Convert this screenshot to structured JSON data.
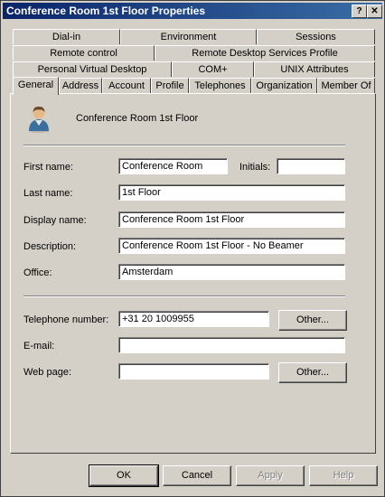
{
  "window": {
    "title": "Conference Room 1st Floor Properties",
    "help_glyph": "?",
    "close_glyph": "✕"
  },
  "tabs": {
    "row1": [
      "Dial-in",
      "Environment",
      "Sessions"
    ],
    "row2": [
      "Remote control",
      "Remote Desktop Services Profile"
    ],
    "row3": [
      "Personal Virtual Desktop",
      "COM+",
      "UNIX Attributes"
    ],
    "row4": [
      "General",
      "Address",
      "Account",
      "Profile",
      "Telephones",
      "Organization",
      "Member Of"
    ],
    "active": "General"
  },
  "general": {
    "display_title": "Conference Room 1st Floor",
    "icon": "user-icon",
    "fields": {
      "first_name_label": "First name:",
      "first_name": "Conference Room",
      "initials_label": "Initials:",
      "initials": "",
      "last_name_label": "Last name:",
      "last_name": "1st Floor",
      "display_name_label": "Display name:",
      "display_name": "Conference Room 1st Floor",
      "description_label": "Description:",
      "description": "Conference Room 1st Floor - No Beamer",
      "office_label": "Office:",
      "office": "Amsterdam",
      "telephone_label": "Telephone number:",
      "telephone": "+31 20 1009955",
      "email_label": "E-mail:",
      "email": "",
      "webpage_label": "Web page:",
      "webpage": ""
    },
    "other_phone_label": "Other...",
    "other_web_label": "Other..."
  },
  "buttons": {
    "ok": "OK",
    "cancel": "Cancel",
    "apply": "Apply",
    "help": "Help"
  }
}
